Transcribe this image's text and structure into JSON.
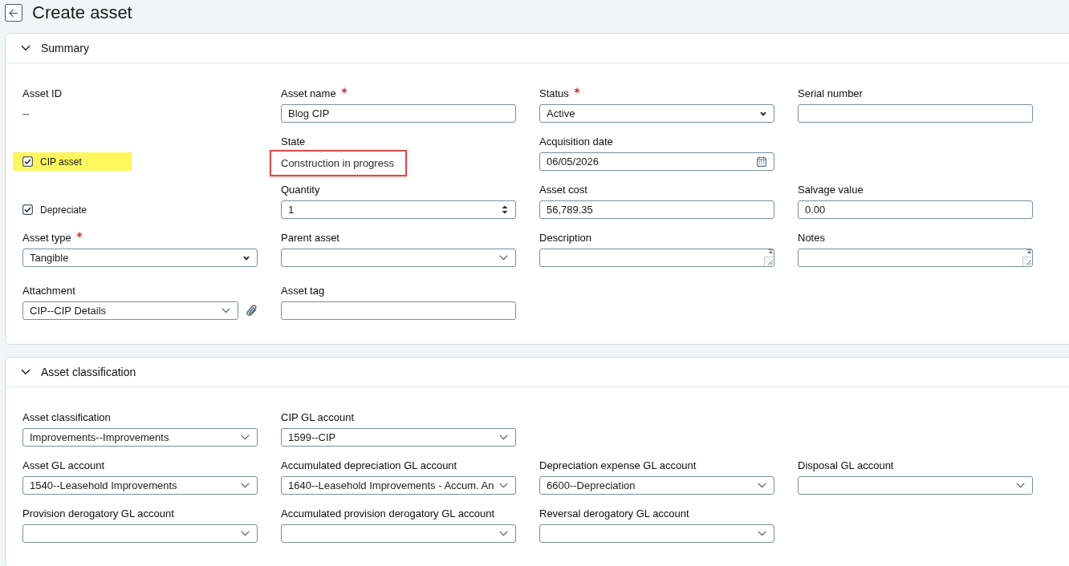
{
  "header": {
    "title": "Create asset"
  },
  "sections": [
    {
      "title": "Summary",
      "expanded": true,
      "rows": [
        [
          {
            "kind": "readonly",
            "label": "Asset ID",
            "required": false,
            "value": "--",
            "outlined": false
          },
          {
            "kind": "text",
            "label": "Asset name",
            "required": true,
            "value": "Blog CIP"
          },
          {
            "kind": "select",
            "label": "Status",
            "required": true,
            "value": "Active"
          },
          {
            "kind": "text",
            "label": "Serial number",
            "required": false
          }
        ],
        [
          {
            "kind": "checkbox",
            "label": "CIP asset",
            "checked": true,
            "highlighted": true
          },
          {
            "kind": "readonly",
            "label": "State",
            "required": false,
            "value": "Construction in progress",
            "outlined": true
          },
          {
            "kind": "date",
            "label": "Acquisition date",
            "required": false,
            "value": "06/05/2026"
          }
        ],
        [
          {
            "kind": "checkbox",
            "label": "Depreciate",
            "checked": true,
            "highlighted": false
          },
          {
            "kind": "number",
            "label": "Quantity",
            "required": false,
            "value": "1"
          },
          {
            "kind": "text",
            "label": "Asset cost",
            "required": false,
            "value": "56,789.35"
          },
          {
            "kind": "text",
            "label": "Salvage value",
            "required": false,
            "value": "0.00"
          }
        ],
        [
          {
            "kind": "select",
            "label": "Asset type",
            "required": true,
            "value": "Tangible"
          },
          {
            "kind": "combo",
            "label": "Parent asset",
            "required": false
          },
          {
            "kind": "textarea",
            "label": "Description",
            "required": false
          },
          {
            "kind": "textarea",
            "label": "Notes",
            "required": false
          }
        ],
        [
          {
            "kind": "combo",
            "label": "Attachment",
            "required": false,
            "value": "CIP--CIP Details",
            "attach_button": true
          },
          {
            "kind": "text",
            "label": "Asset tag",
            "required": false
          }
        ]
      ]
    },
    {
      "title": "Asset classification",
      "expanded": true,
      "rows": [
        [
          {
            "kind": "combo",
            "label": "Asset classification",
            "required": false,
            "value": "Improvements--Improvements"
          },
          {
            "kind": "combo",
            "label": "CIP GL account",
            "required": false,
            "value": "1599--CIP"
          }
        ],
        [
          {
            "kind": "combo",
            "label": "Asset GL account",
            "required": false,
            "value": "1540--Leasehold Improvements"
          },
          {
            "kind": "combo",
            "label": "Accumulated depreciation GL account",
            "required": false,
            "value": "1640--Leasehold Improvements - Accum. An"
          },
          {
            "kind": "combo",
            "label": "Depreciation expense GL account",
            "required": false,
            "value": "6600--Depreciation"
          },
          {
            "kind": "combo",
            "label": "Disposal GL account",
            "required": false
          }
        ],
        [
          {
            "kind": "combo",
            "label": "Provision derogatory GL account",
            "required": false
          },
          {
            "kind": "combo",
            "label": "Accumulated provision derogatory GL account",
            "required": false
          },
          {
            "kind": "combo",
            "label": "Reversal derogatory GL account",
            "required": false
          }
        ]
      ]
    }
  ]
}
